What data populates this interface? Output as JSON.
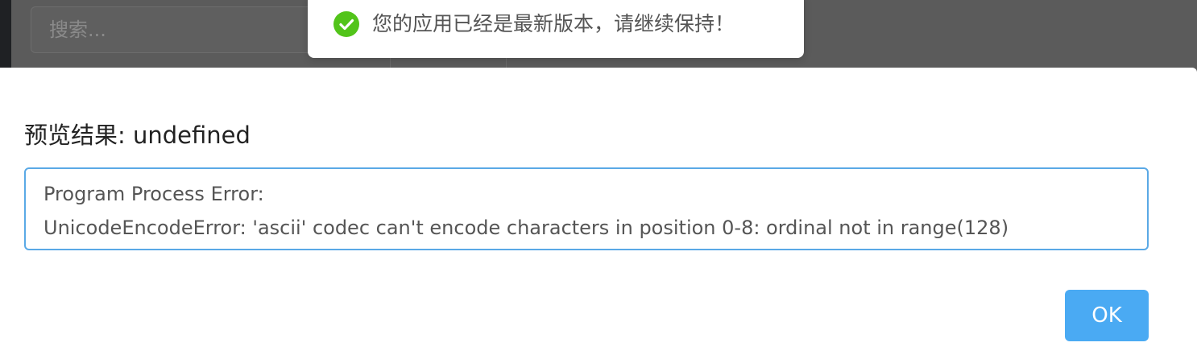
{
  "background": {
    "search_placeholder": "搜索..."
  },
  "toast": {
    "icon": "check-circle-icon",
    "message": "您的应用已经是最新版本，请继续保持！",
    "color": "#52c41a"
  },
  "dialog": {
    "result_label": "预览结果: undefined",
    "output_lines": [
      "Program Process Error:",
      "UnicodeEncodeError: 'ascii' codec can't encode characters in position 0-8: ordinal not in range(128)"
    ],
    "ok_label": "OK",
    "accent_color": "#4aaaf3"
  }
}
